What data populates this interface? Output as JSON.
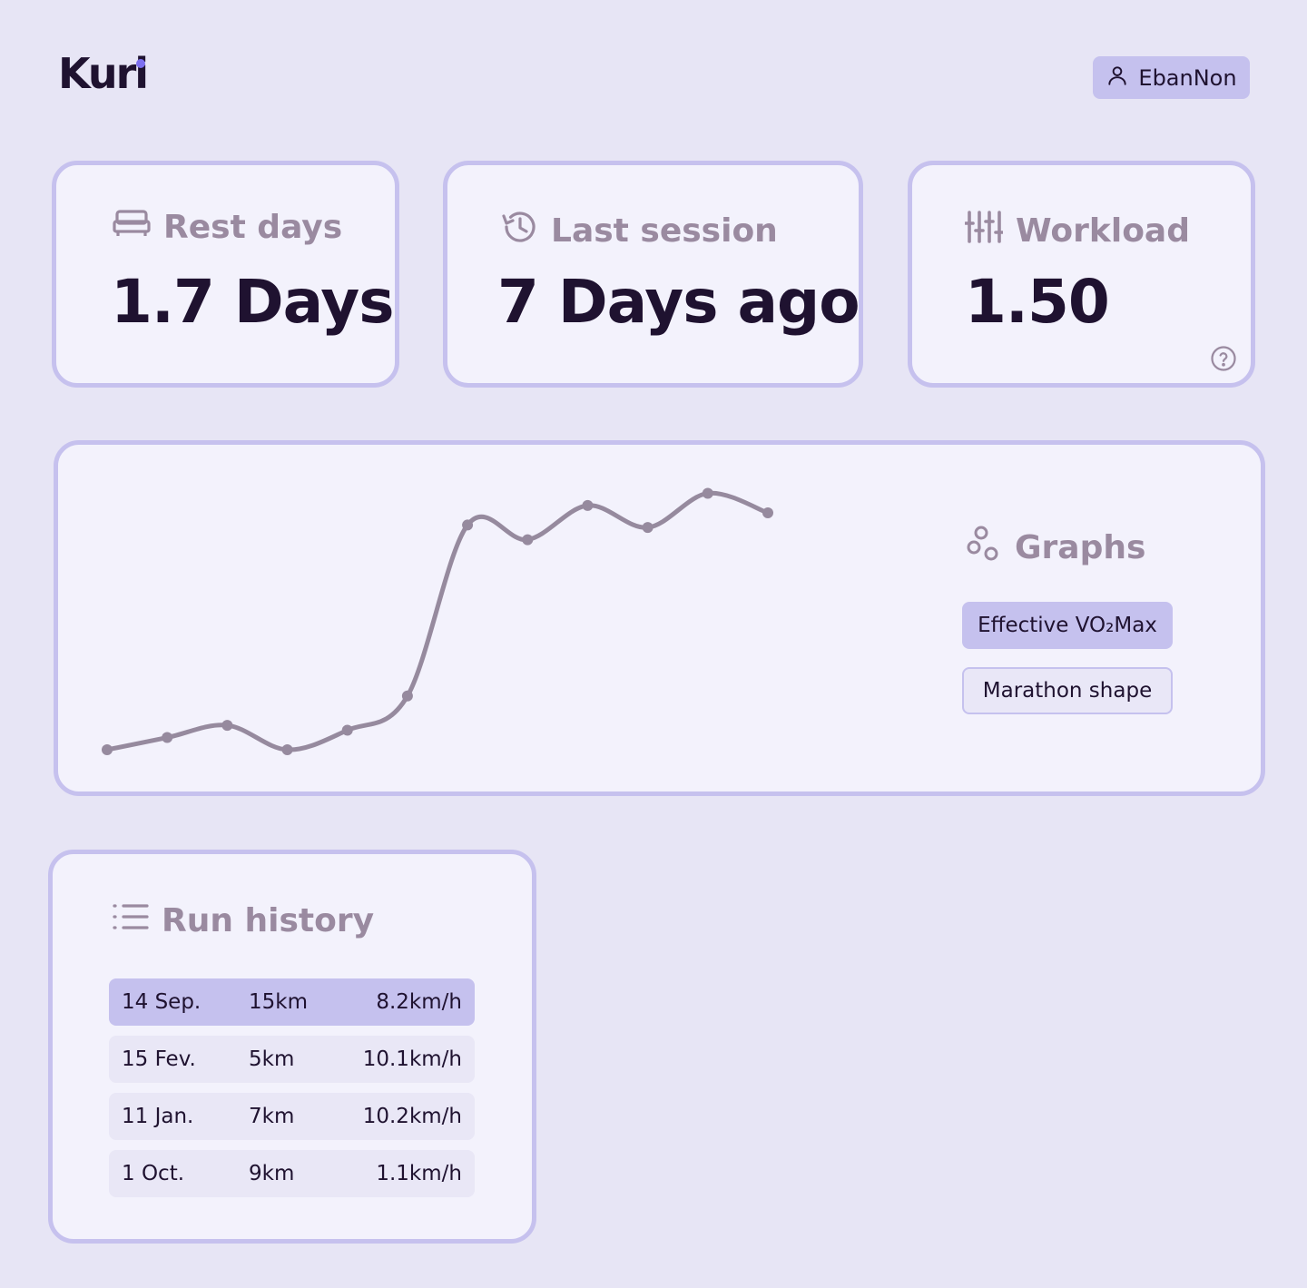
{
  "header": {
    "logo": "Kuri",
    "user": "EbanNon"
  },
  "stats": [
    {
      "label": "Rest days",
      "value": "1.7 Days",
      "icon": "bed-icon"
    },
    {
      "label": "Last session",
      "value": "7 Days ago",
      "icon": "history-icon"
    },
    {
      "label": "Workload",
      "value": "1.50",
      "icon": "sliders-icon",
      "help_icon": "help-circle-icon"
    }
  ],
  "graphs": {
    "title": "Graphs",
    "icon": "nodes-icon",
    "options": [
      {
        "label": "Effective VO₂Max",
        "selected": true
      },
      {
        "label": "Marathon shape",
        "selected": false
      }
    ]
  },
  "chart_data": {
    "type": "line",
    "title": "",
    "xlabel": "",
    "ylabel": "",
    "grid": false,
    "series": [
      {
        "values": [
          0,
          5,
          10,
          0,
          8,
          22,
          92,
          86,
          100,
          91,
          105,
          97
        ]
      }
    ],
    "ylim": [
      0,
      110
    ],
    "line_color": "#968a9e"
  },
  "history": {
    "title": "Run history",
    "icon": "list-icon",
    "runs": [
      {
        "date": "14 Sep.",
        "distance": "15km",
        "speed": "8.2km/h"
      },
      {
        "date": "15 Fev.",
        "distance": "5km",
        "speed": "10.1km/h"
      },
      {
        "date": "11 Jan.",
        "distance": "7km",
        "speed": "10.2km/h"
      },
      {
        "date": "1 Oct.",
        "distance": "9km",
        "speed": "1.1km/h"
      }
    ]
  },
  "colors": {
    "background": "#e7e5f5",
    "card": "#f3f2fc",
    "accent": "#c5c1ee",
    "logo_dot": "#7d6ff0",
    "muted_text": "#9a8aa0"
  }
}
